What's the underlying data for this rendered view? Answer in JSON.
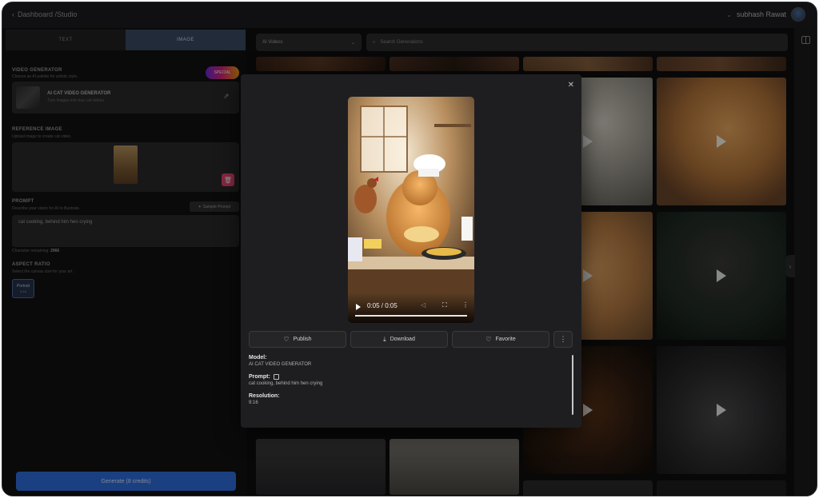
{
  "breadcrumb": {
    "back_icon": "chevron-left-icon",
    "label": "Dashboard /Studio"
  },
  "user": {
    "name": "subhash Rawat"
  },
  "left": {
    "tabs": [
      {
        "label": "TEXT"
      },
      {
        "label": "IMAGE"
      }
    ],
    "video_generator": {
      "title": "VIDEO GENERATOR",
      "subtitle": "Choose an AI palette for artistic style.",
      "badge": "SPECIAL",
      "model_name": "AI CAT VIDEO GENERATOR",
      "model_desc": "Turn images into true cat videos"
    },
    "reference": {
      "title": "REFERENCE IMAGE",
      "subtitle": "Upload image to create cat video."
    },
    "prompt": {
      "title": "PROMPT",
      "subtitle": "Describe your vision for AI to illustrate.",
      "sample_label": "Sample Prompt",
      "value": "cat cooking, behind him hen crying",
      "chars_label": "Character remaining:",
      "chars_value": "2966"
    },
    "aspect": {
      "title": "ASPECT RATIO",
      "subtitle": "Select the canvas size for your art.",
      "option_label": "Portrait",
      "option_ratio": "9:16"
    },
    "generate_label": "Generate (8 credits)"
  },
  "right": {
    "filter_value": "AI Videos",
    "search_placeholder": "Search Generations"
  },
  "modal": {
    "video_time": "0:05 / 0:05",
    "video_progress": 1.0,
    "actions": [
      {
        "label": "Publish"
      },
      {
        "label": "Download"
      },
      {
        "label": "Favorite"
      }
    ],
    "model_label": "Model:",
    "model_value": "AI CAT VIDEO GENERATOR",
    "prompt_label": "Prompt:",
    "prompt_value": "cat cooking, behind him hen crying",
    "resolution_label": "Resolution:",
    "resolution_value": "9:16"
  },
  "colors": {
    "accent": "#2f6fe0",
    "active_tab": "#3a4a63",
    "delete": "#e7446f"
  }
}
